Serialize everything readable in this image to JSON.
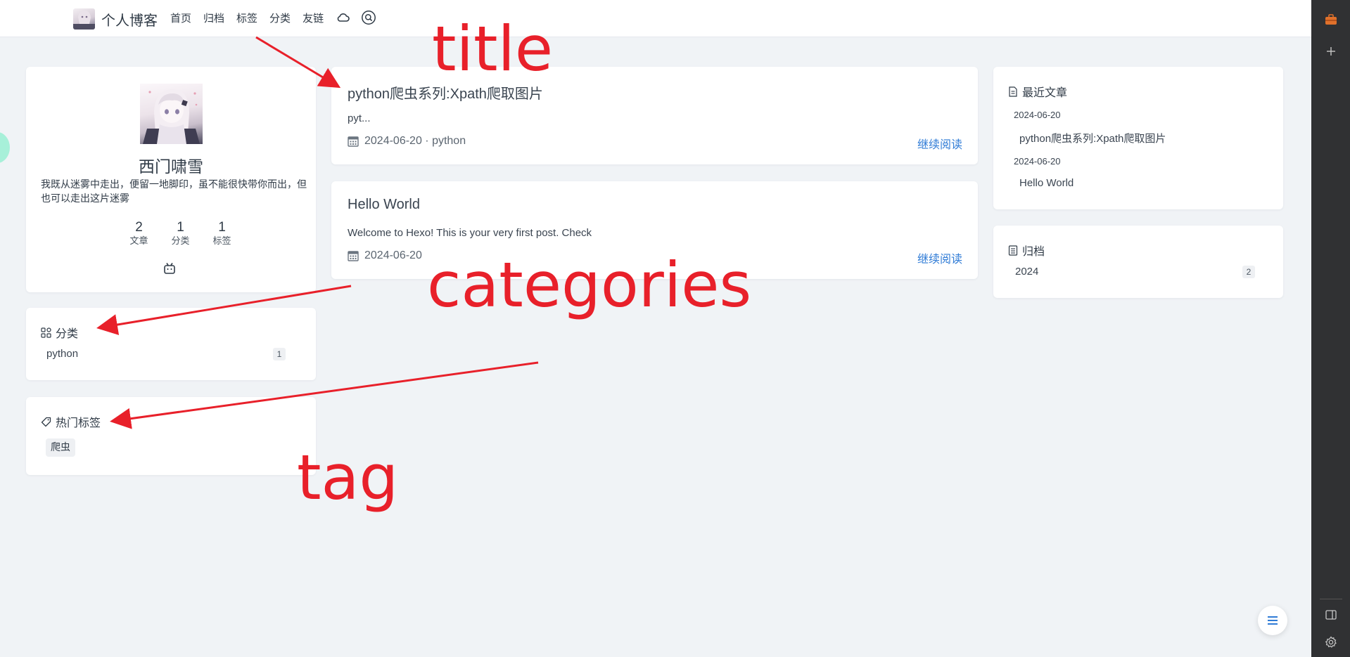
{
  "nav": {
    "brand_title": "个人博客",
    "items": [
      "首页",
      "归档",
      "标签",
      "分类",
      "友链"
    ],
    "weather_icon": "cloud-icon",
    "search_icon": "search-icon"
  },
  "profile": {
    "name": "西门啸雪",
    "bio": "我既从迷雾中走出，便留一地脚印，虽不能很快带你而出，但也可以走出这片迷雾",
    "stats": [
      {
        "value": "2",
        "label": "文章"
      },
      {
        "value": "1",
        "label": "分类"
      },
      {
        "value": "1",
        "label": "标签"
      }
    ],
    "social_icon": "bilibili-icon"
  },
  "categories_widget": {
    "title": "分类",
    "items": [
      {
        "name": "python",
        "count": "1"
      }
    ]
  },
  "tags_widget": {
    "title": "热门标签",
    "tags": [
      "爬虫"
    ]
  },
  "posts": [
    {
      "title": "python爬虫系列:Xpath爬取图片",
      "excerpt": "pyt...",
      "meta": "2024-06-20 · python",
      "read_more": "继续阅读"
    },
    {
      "title": "Hello World",
      "excerpt": "Welcome to Hexo! This is your very first post. Check",
      "meta": "2024-06-20",
      "read_more": "继续阅读"
    }
  ],
  "recent_widget": {
    "title": "最近文章",
    "items": [
      {
        "date": "2024-06-20",
        "title": "python爬虫系列:Xpath爬取图片"
      },
      {
        "date": "2024-06-20",
        "title": "Hello World"
      }
    ]
  },
  "archive_widget": {
    "title": "归档",
    "items": [
      {
        "year": "2024",
        "count": "2"
      }
    ]
  },
  "annotations": {
    "title": "title",
    "categories": "categories",
    "tag": "tag"
  },
  "colors": {
    "accent_link": "#2f7bd6",
    "annotation_red": "#e8202a",
    "background": "#f0f3f6",
    "dock": "#303133"
  }
}
